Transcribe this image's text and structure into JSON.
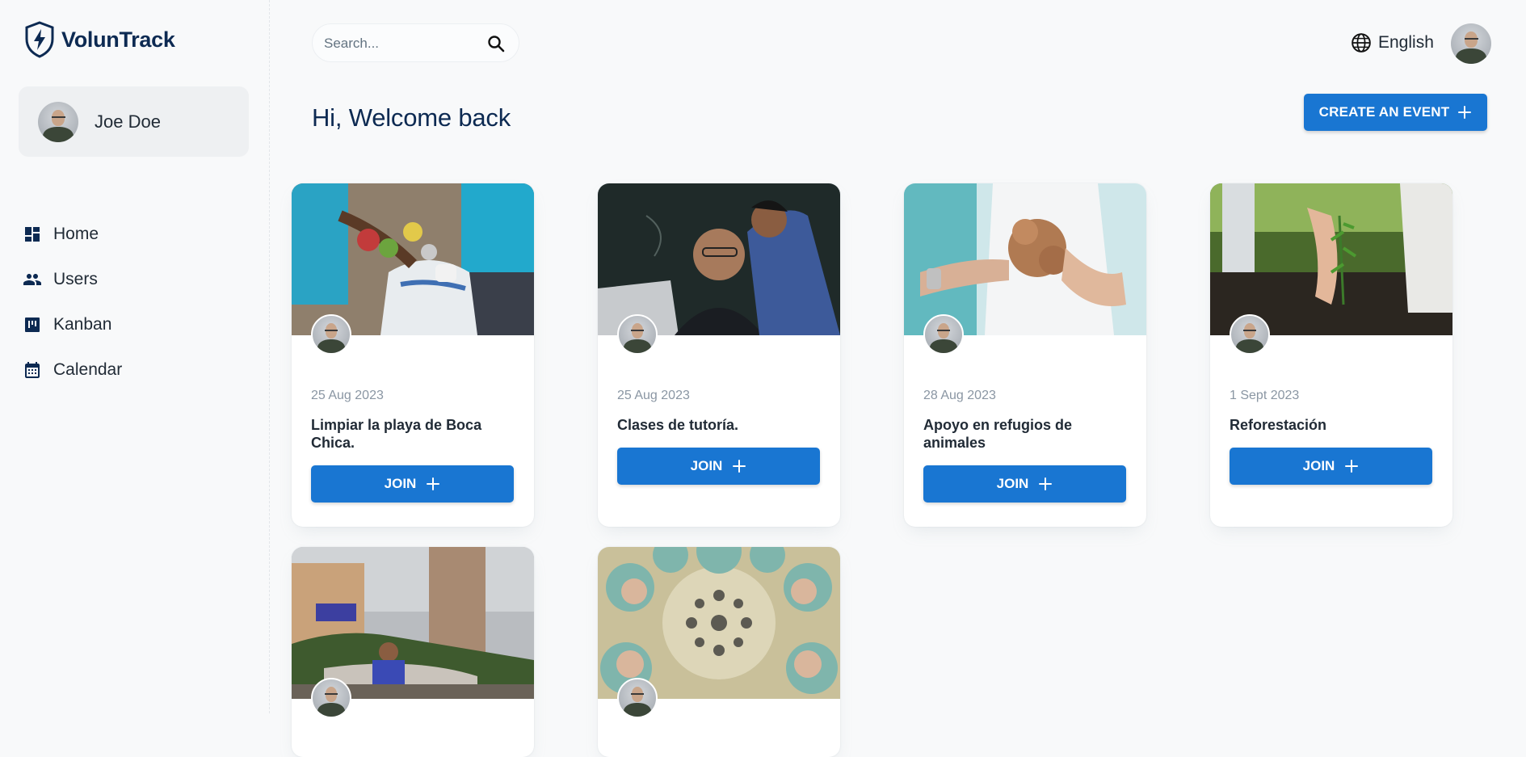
{
  "app": {
    "name": "VolunTrack"
  },
  "user": {
    "name": "Joe Doe"
  },
  "nav": [
    {
      "label": "Home",
      "icon": "dashboard-icon"
    },
    {
      "label": "Users",
      "icon": "users-icon"
    },
    {
      "label": "Kanban",
      "icon": "kanban-icon"
    },
    {
      "label": "Calendar",
      "icon": "calendar-icon"
    }
  ],
  "search": {
    "placeholder": "Search...",
    "value": ""
  },
  "language": {
    "label": "English"
  },
  "header": {
    "welcome": "Hi, Welcome back",
    "create_label": "CREATE AN EVENT"
  },
  "events": [
    {
      "date": "25 Aug 2023",
      "title": "Limpiar la playa de Boca Chica.",
      "join_label": "JOIN"
    },
    {
      "date": "25 Aug 2023",
      "title": "Clases de tutoría.",
      "join_label": "JOIN"
    },
    {
      "date": "28 Aug 2023",
      "title": "Apoyo en refugios de animales",
      "join_label": "JOIN"
    },
    {
      "date": "1 Sept 2023",
      "title": "Reforestación",
      "join_label": "JOIN"
    },
    {
      "date": "",
      "title": "",
      "join_label": ""
    },
    {
      "date": "",
      "title": "",
      "join_label": ""
    }
  ],
  "colors": {
    "primary": "#1976d2",
    "navy": "#0d2a52",
    "background": "#f8f9fa"
  }
}
